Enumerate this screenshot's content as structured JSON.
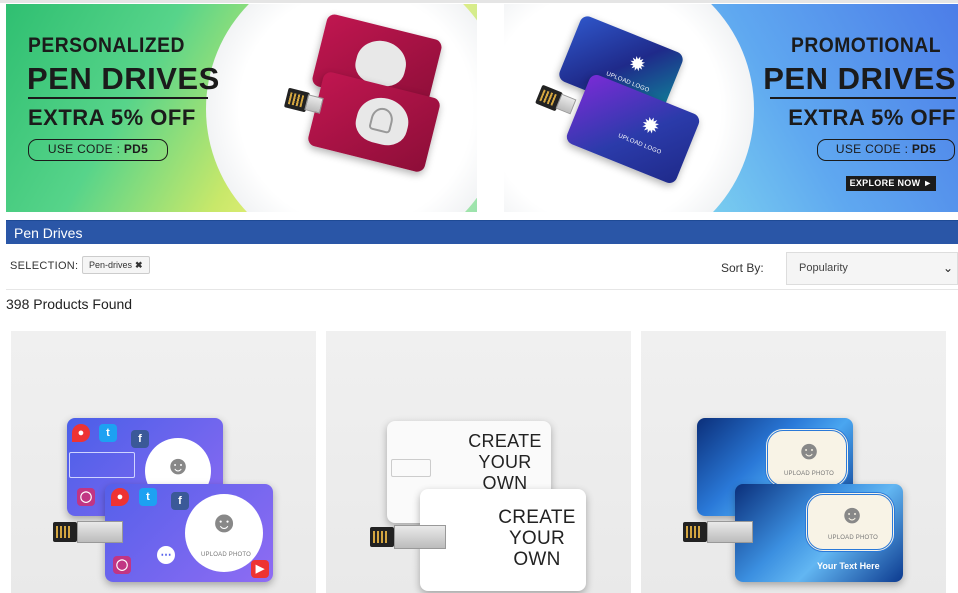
{
  "banners": {
    "left": {
      "line1": "PERSONALIZED",
      "line2": "PEN DRIVES",
      "offer": "EXTRA 5% OFF",
      "code_prefix": "USE CODE : ",
      "code": "PD5"
    },
    "right": {
      "line1": "PROMOTIONAL",
      "line2": "PEN DRIVES",
      "offer": "EXTRA 5% OFF",
      "code_prefix": "USE CODE : ",
      "code": "PD5",
      "cta": "EXPLORE NOW",
      "cta_icon": "play-arrow-icon",
      "card_logo_text": "UPLOAD LOGO"
    }
  },
  "section": {
    "title": "Pen Drives"
  },
  "filters": {
    "selection_label": "SELECTION:",
    "chips": [
      {
        "label": "Pen-drives",
        "remove_icon": "close-icon"
      }
    ]
  },
  "sort": {
    "label": "Sort By:",
    "selected": "Popularity"
  },
  "results": {
    "count_text": "398 Products Found"
  },
  "products": [
    {
      "art": "social-media-card",
      "photo_text": "UPLOAD PHOTO"
    },
    {
      "art": "create-your-own-card",
      "text": "CREATE YOUR OWN"
    },
    {
      "art": "blue-crystal-card",
      "photo_text": "UPLOAD PHOTO",
      "caption": "Your Text Here"
    }
  ],
  "colors": {
    "section_bar": "#2a56a7",
    "left_banner": "#2fbf71",
    "right_banner": "#4c7de8",
    "card_magenta": "#a3123f",
    "card_navy": "#1f2a8a",
    "card_purple": "#6b5cf0"
  }
}
